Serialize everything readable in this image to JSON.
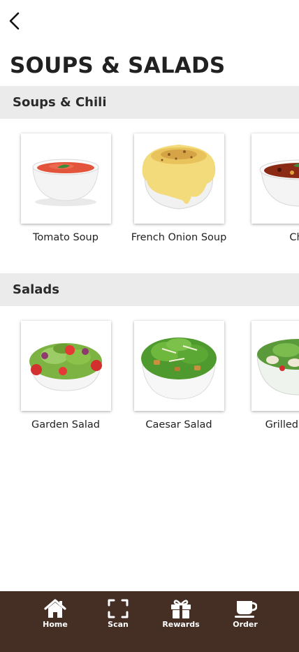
{
  "header": {
    "back_icon": "chevron-left-icon",
    "title": "SOUPS & SALADS"
  },
  "sections": [
    {
      "title": "Soups & Chili",
      "items": [
        {
          "label": "Tomato Soup",
          "image": "tomato-soup-bowl"
        },
        {
          "label": "French Onion Soup",
          "image": "french-onion-soup-crock"
        },
        {
          "label": "Ch",
          "image": "chili-bowl"
        }
      ]
    },
    {
      "title": "Salads",
      "items": [
        {
          "label": "Garden Salad",
          "image": "garden-salad-bowl"
        },
        {
          "label": "Caesar Salad",
          "image": "caesar-salad-bowl"
        },
        {
          "label": "Grilled C Sal",
          "image": "grilled-chicken-salad-bowl"
        }
      ]
    }
  ],
  "bottom_nav": {
    "items": [
      {
        "label": "Home",
        "icon": "home-icon"
      },
      {
        "label": "Scan",
        "icon": "scan-icon"
      },
      {
        "label": "Rewards",
        "icon": "gift-icon"
      },
      {
        "label": "Order",
        "icon": "coffee-cup-icon"
      }
    ]
  },
  "colors": {
    "nav_background": "#452f25",
    "section_header_background": "#ebebeb",
    "title_text": "#212121"
  }
}
